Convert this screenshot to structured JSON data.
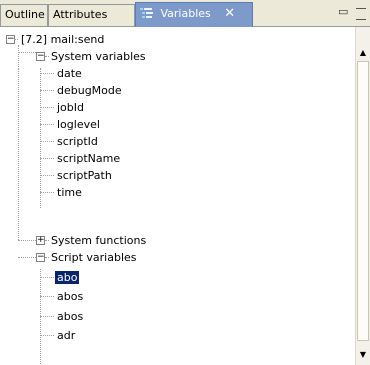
{
  "tabs": [
    {
      "label": "Outline"
    },
    {
      "label": "Attributes"
    },
    {
      "label": "Variables",
      "icon": "variables-icon",
      "active": true
    }
  ],
  "window_buttons": {
    "minimize": "minimize",
    "maximize": "maximize"
  },
  "tree": {
    "root": {
      "label": "[7.2] mail:send",
      "expanded": true
    },
    "system_variables": {
      "label": "System variables",
      "expanded": true,
      "items": [
        "date",
        "debugMode",
        "jobId",
        "loglevel",
        "scriptId",
        "scriptName",
        "scriptPath",
        "time"
      ]
    },
    "system_functions": {
      "label": "System functions",
      "expanded": false
    },
    "script_variables": {
      "label": "Script variables",
      "expanded": true,
      "items": [
        "abo",
        "abos",
        "abos",
        "adr"
      ],
      "selected_index": 0
    }
  },
  "colors": {
    "active_tab": "#7d9acb",
    "selection": "#0a246a",
    "tabbar_bg": "#ece9d8"
  }
}
